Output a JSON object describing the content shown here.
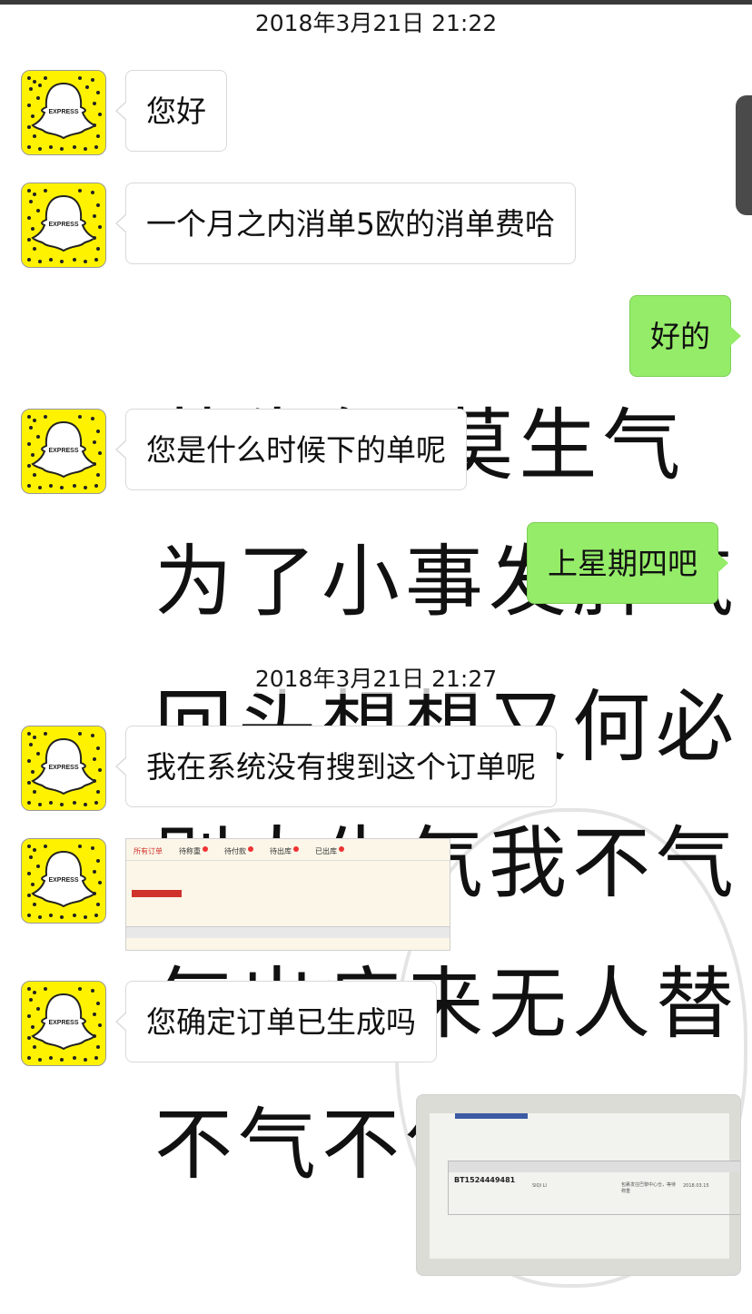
{
  "timestamps": [
    "2018年3月21日  21:22",
    "2018年3月21日  21:27"
  ],
  "colors": {
    "sent_bubble": "#95ec69",
    "received_bubble": "#ffffff",
    "avatar_bg": "#fff200"
  },
  "avatar": {
    "icon": "snapchat-ghost-icon",
    "label": "EXPRESS"
  },
  "messages": [
    {
      "from": "other",
      "text": "您好"
    },
    {
      "from": "other",
      "text": "一个月之内消单5欧的消单费哈"
    },
    {
      "from": "me",
      "text": "好的"
    },
    {
      "from": "other",
      "text": "您是什么时候下的单呢"
    },
    {
      "from": "me",
      "text": "上星期四吧"
    },
    {
      "from": "other",
      "text": "我在系统没有搜到这个订单呢"
    },
    {
      "from": "other",
      "type": "image",
      "text": ""
    },
    {
      "from": "other",
      "text": "您确定订单已生成吗"
    },
    {
      "from": "me",
      "type": "image",
      "text": ""
    }
  ],
  "screenshot_image": {
    "tabs": [
      "所有订单",
      "待称重",
      "待付款",
      "待出库",
      "已出库"
    ]
  },
  "photo_image": {
    "order_id": "BT1524449481",
    "sender": "SIQI LI",
    "status": "包裹发往巴黎中心仓，等待称重",
    "date": "2018.03.15"
  },
  "background_poem": [
    "莫生气 莫生气",
    "为了小事发脾气",
    "回头想想又何必",
    "别人生气我不气",
    "气出病来无人替",
    "不气不气不气"
  ]
}
